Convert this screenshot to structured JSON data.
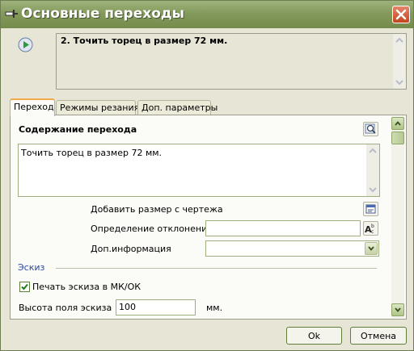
{
  "window": {
    "title": "Основные переходы"
  },
  "step": {
    "text": "2.  Точить торец в размер 72 мм."
  },
  "tabs": [
    {
      "label": "Переход",
      "active": true
    },
    {
      "label": "Режимы резания",
      "active": false
    },
    {
      "label": "Доп. параметры",
      "active": false
    }
  ],
  "content": {
    "section_title": "Содержание перехода",
    "text": "Точить торец в размер 72 мм.",
    "add_size_label": "Добавить размер с чертежа",
    "deviation_label": "Определение отклонений",
    "deviation_value": "",
    "extra_info_label": "Доп.информация",
    "extra_info_value": ""
  },
  "sketch": {
    "title": "Эскиз",
    "print_label": "Печать эскиза в МК/ОК",
    "print_checked": true,
    "height_label": "Высота поля эскиза",
    "height_value": "100",
    "unit": "мм."
  },
  "buttons": {
    "ok": "Ok",
    "cancel": "Отмена"
  },
  "icons": {
    "pin": "pin-icon",
    "close": "close-icon",
    "play": "play-icon",
    "find": "find-icon",
    "add_size": "add-size-icon",
    "spell": "spell-check-icon"
  },
  "colors": {
    "titlebar": "#839a5c",
    "window": "#e7e5d6",
    "active_tab": "#f2a94a",
    "sketch_title": "#2a4aa0"
  }
}
